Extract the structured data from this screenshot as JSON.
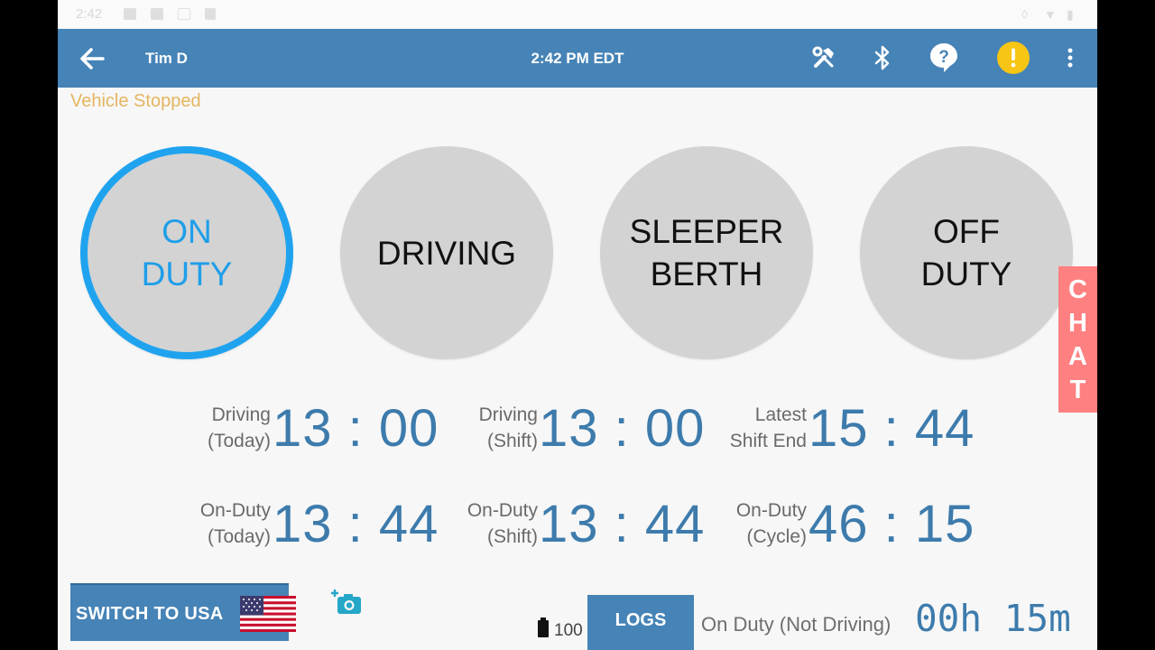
{
  "statusbar": {
    "time": "2:42"
  },
  "header": {
    "driver_name": "Tim D",
    "clock": "2:42 PM EDT",
    "icons": [
      "back-arrow-icon",
      "tools-icon",
      "bluetooth-icon",
      "help-icon",
      "alert-icon",
      "more-vert-icon"
    ],
    "alert_color": "#f7c513",
    "bar_color": "#4683b6"
  },
  "vehicle_status": "Vehicle Stopped",
  "duty_status": {
    "active": "on_duty",
    "active_color": "#1fa3ef",
    "buttons": [
      {
        "id": "on_duty",
        "line1": "ON",
        "line2": "DUTY"
      },
      {
        "id": "driving",
        "line1": "DRIVING",
        "line2": ""
      },
      {
        "id": "sleeper_berth",
        "line1": "SLEEPER",
        "line2": "BERTH"
      },
      {
        "id": "off_duty",
        "line1": "OFF",
        "line2": "DUTY"
      }
    ]
  },
  "chat": {
    "label": "CHAT",
    "letters": [
      "C",
      "H",
      "A",
      "T"
    ],
    "color": "#ff8080"
  },
  "clocks": {
    "driving_today": {
      "label1": "Driving",
      "label2": "(Today)",
      "value": "13:00"
    },
    "driving_shift": {
      "label1": "Driving",
      "label2": "(Shift)",
      "value": "13:00"
    },
    "latest_shift_end": {
      "label1": "Latest",
      "label2": "Shift End",
      "value": "15:44"
    },
    "on_duty_today": {
      "label1": "On-Duty",
      "label2": "(Today)",
      "value": "13:44"
    },
    "on_duty_shift": {
      "label1": "On-Duty",
      "label2": "(Shift)",
      "value": "13:44"
    },
    "on_duty_cycle": {
      "label1": "On-Duty",
      "label2": "(Cycle)",
      "value": "46:15"
    }
  },
  "footer": {
    "switch_label": "SWITCH TO USA",
    "flag": "usa-flag-icon",
    "camera": "add-photo-icon",
    "battery_pct": "100",
    "logs_label": "LOGS",
    "current_status": "On Duty (Not Driving)",
    "current_timer": "00h 15m"
  }
}
